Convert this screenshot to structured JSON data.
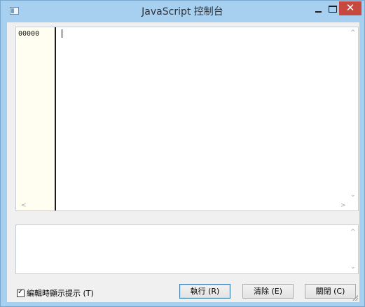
{
  "window": {
    "title": "JavaScript 控制台",
    "close_glyph": "✕"
  },
  "editor": {
    "line_number": "00000",
    "content": ""
  },
  "output": {
    "content": ""
  },
  "scroll_arrows": {
    "up": "^",
    "down": "⌄",
    "left": "<",
    "right": ">"
  },
  "options": {
    "hint_label": "編輯時顯示提示 (T)",
    "hint_checked": true
  },
  "buttons": {
    "run": "執行 (R)",
    "clear": "清除 (E)",
    "close": "關閉 (C)"
  },
  "colors": {
    "frame": "#a7cff0",
    "close_button": "#c7483f",
    "gutter_bg": "#fffef0"
  }
}
